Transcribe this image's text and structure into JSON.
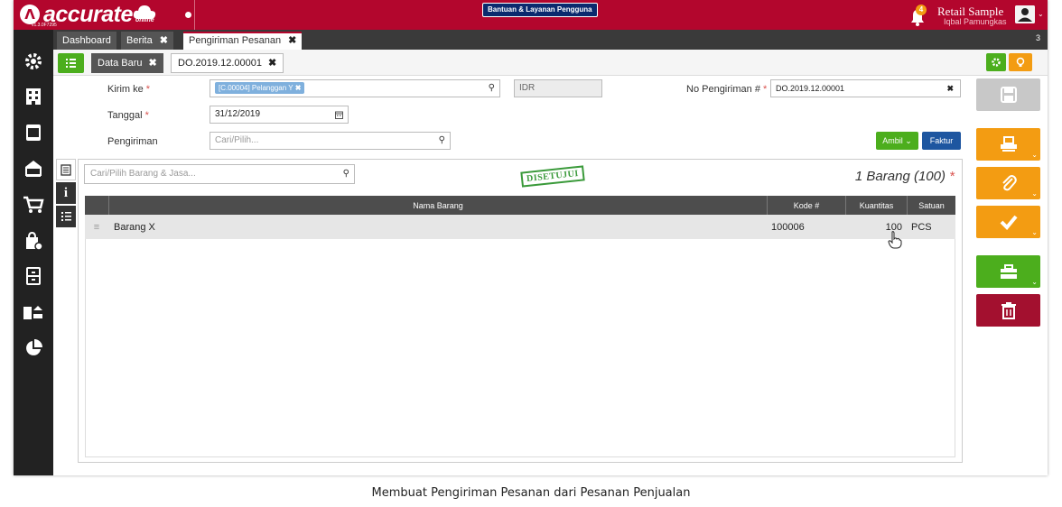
{
  "app": {
    "logo_mark": "Λ",
    "logo_text": "accurate",
    "logo_online": "online",
    "version": "v1.3.0F7295",
    "help_button": "Bantuan & Layanan Pengguna",
    "notification_count": "4",
    "user_name": "Retail Sample",
    "user_sub": "Iqbal Pamungkas",
    "brand_color": "#b3062d"
  },
  "tabs": [
    {
      "label": "Dashboard"
    },
    {
      "label": "Berita",
      "close": "✖"
    },
    {
      "label": "Pengiriman Pesanan",
      "close": "✖"
    }
  ],
  "tab_count": "3",
  "subtabs": {
    "data_baru": "Data Baru",
    "current": "DO.2019.12.00001",
    "close": "✖"
  },
  "form": {
    "kirim_ke_label": "Kirim ke",
    "kirim_ke_value": "[C.00004] Pelanggan Y",
    "currency": "IDR",
    "tanggal_label": "Tanggal",
    "tanggal_value": "31/12/2019",
    "pengiriman_label": "Pengiriman",
    "pengiriman_placeholder": "Cari/Pilih...",
    "no_pengiriman_label": "No Pengiriman #",
    "no_pengiriman_value": "DO.2019.12.00001",
    "required_mark": "*",
    "ambil_button": "Ambil",
    "faktur_button": "Faktur"
  },
  "detail": {
    "search_placeholder": "Cari/Pilih Barang & Jasa...",
    "status_stamp": "DISETUJUI",
    "count_label": "1 Barang (100)",
    "columns": [
      "Nama Barang",
      "Kode #",
      "Kuantitas",
      "Satuan"
    ],
    "rows": [
      {
        "nama": "Barang X",
        "kode": "100006",
        "kuantitas": "100",
        "satuan": "PCS"
      }
    ]
  },
  "actions": [
    {
      "name": "save",
      "color": "#c8c8c8"
    },
    {
      "name": "print",
      "color": "#f39c12"
    },
    {
      "name": "attach",
      "color": "#f39c12"
    },
    {
      "name": "approve",
      "color": "#f39c12"
    },
    {
      "name": "tools",
      "color": "#4cae1d"
    },
    {
      "name": "delete",
      "color": "#a3102f"
    }
  ],
  "caption": "Membuat Pengiriman Pesanan dari Pesanan Penjualan"
}
